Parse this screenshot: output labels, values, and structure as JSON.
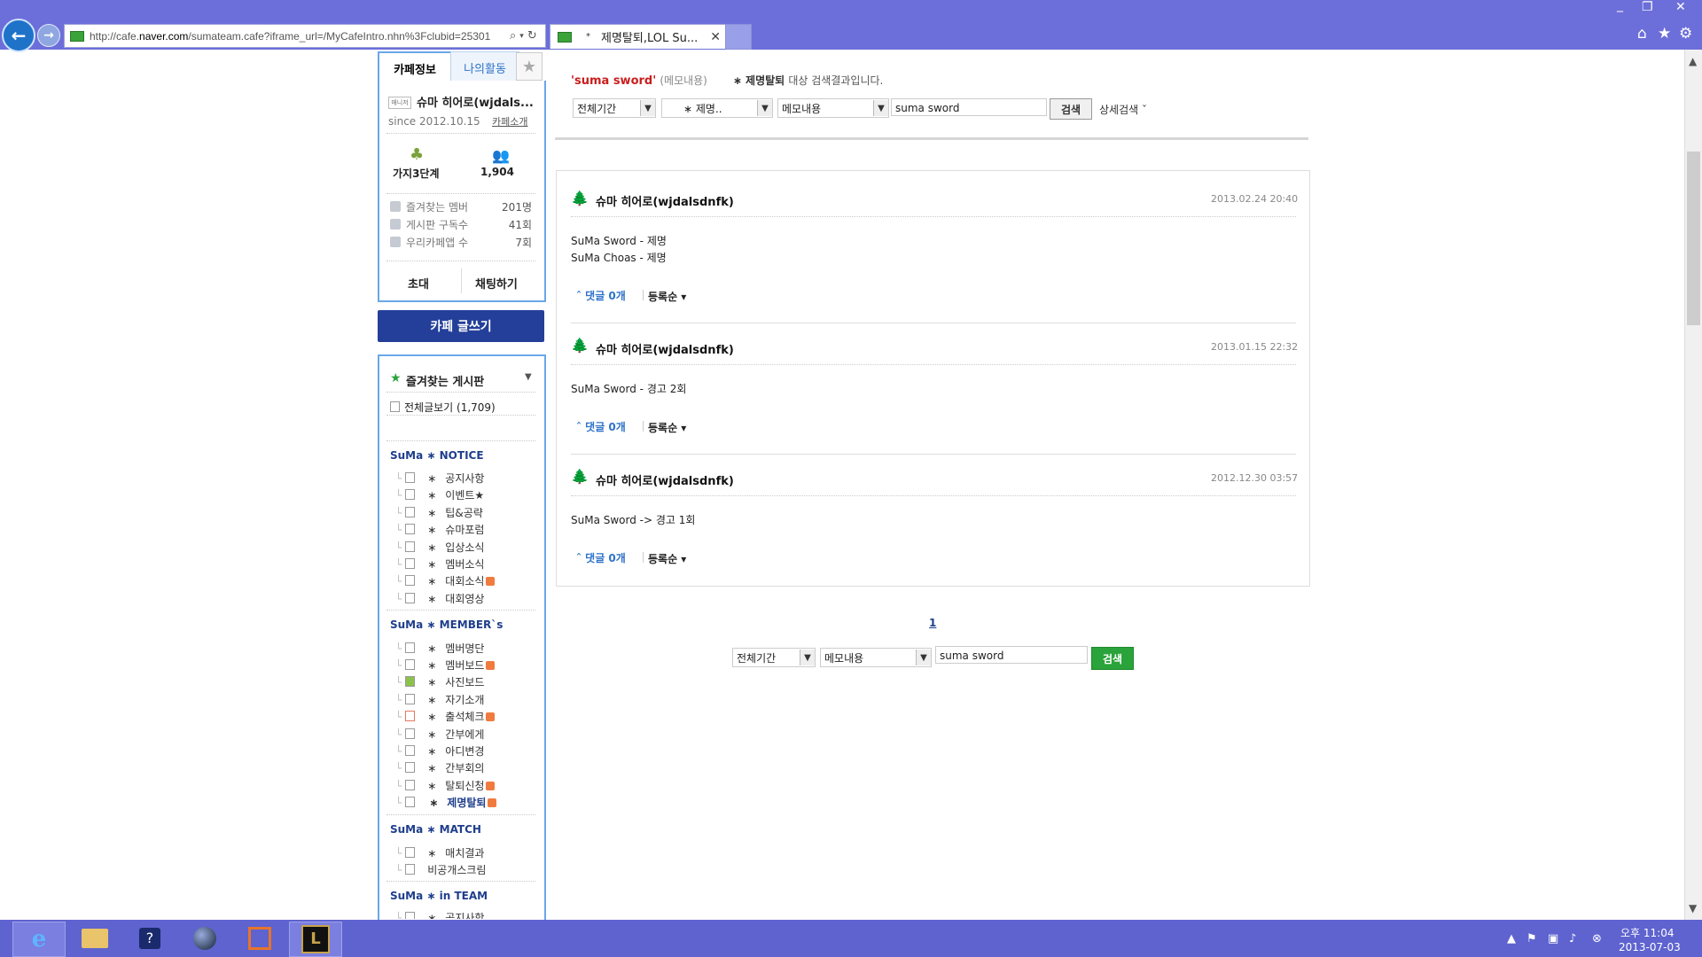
{
  "browser": {
    "url_prefix": "http://cafe.",
    "url_domain": "naver.com",
    "url_rest": "/sumateam.cafe?iframe_url=/MyCafeIntro.nhn%3Fclubid=25301",
    "tab_title": "제명탈퇴,LOL Su...",
    "tab_marker": "*"
  },
  "icons": {
    "back": "back-arrow-icon",
    "forward": "forward-arrow-icon",
    "search": "search-icon",
    "refresh": "refresh-icon",
    "home": "home-icon",
    "favorites": "star-icon",
    "settings": "gear-icon"
  },
  "sidebar": {
    "tab_cafe_info": "카페정보",
    "tab_my_activity": "나의활동",
    "cafe_prefix": "매니저",
    "cafe_name": "슈마 히어로(wjdals...",
    "since": "since 2012.10.15",
    "cafe_intro": "카페소개",
    "level": "가지3단계",
    "members": "1,904",
    "stats": [
      {
        "label": "즐겨찾는 멤버",
        "value": "201명"
      },
      {
        "label": "게시판 구독수",
        "value": "41회"
      },
      {
        "label": "우리카페앱 수",
        "value": "7회"
      }
    ],
    "invite": "초대",
    "chat": "채팅하기",
    "write": "카페 글쓰기",
    "fav_boards": "즐겨찾는 게시판",
    "all_posts": "전체글보기 (1,709)",
    "categories": [
      {
        "title": "SuMa ∗ NOTICE",
        "items": [
          "공지사항",
          "이벤트★",
          "팁&공략",
          "슈마포럼",
          "입상소식",
          "멤버소식",
          "대회소식",
          "대회영상"
        ]
      },
      {
        "title": "SuMa ∗ MEMBER`s",
        "items": [
          "멤버명단",
          "멤버보드",
          "사진보드",
          "자기소개",
          "출석체크",
          "간부에게",
          "아디변경",
          "간부회의",
          "탈퇴신청",
          "제명탈퇴"
        ]
      },
      {
        "title": "SuMa ∗ MATCH",
        "items": [
          "매치결과",
          "비공개스크림"
        ]
      },
      {
        "title": "SuMa ∗ in TEAM",
        "items": [
          "공지사항"
        ]
      }
    ],
    "new_badge": "N"
  },
  "search": {
    "keyword": "'suma sword'",
    "scope": "(메모내용)",
    "board": "∗   제명탈퇴",
    "result_suffix": "대상 검색결과입니다.",
    "period": "전체기간",
    "board_select": "∗ 제명..",
    "field": "메모내용",
    "query": "suma sword",
    "button": "검색",
    "advanced": "상세검색 ˇ"
  },
  "posts": [
    {
      "author": "슈마 히어로(wjdalsdnfk)",
      "date": "2013.02.24 20:40",
      "lines": [
        "SuMa Sword - 제명",
        "SuMa Choas - 제명"
      ],
      "comments": "ˆ 댓글 0개",
      "order": "등록순 ▾"
    },
    {
      "author": "슈마 히어로(wjdalsdnfk)",
      "date": "2013.01.15 22:32",
      "lines": [
        "SuMa Sword - 경고 2회"
      ],
      "comments": "ˆ 댓글 0개",
      "order": "등록순 ▾"
    },
    {
      "author": "슈마 히어로(wjdalsdnfk)",
      "date": "2012.12.30 03:57",
      "lines": [
        "SuMa Sword -> 경고 1회"
      ],
      "comments": "ˆ 댓글 0개",
      "order": "등록순 ▾"
    }
  ],
  "pagination": {
    "current": "1"
  },
  "bottom_search": {
    "period": "전체기간",
    "field": "메모내용",
    "query": "suma sword",
    "button": "검색"
  },
  "taskbar": {
    "clock_time": "오후 11:04",
    "clock_date": "2013-07-03"
  }
}
